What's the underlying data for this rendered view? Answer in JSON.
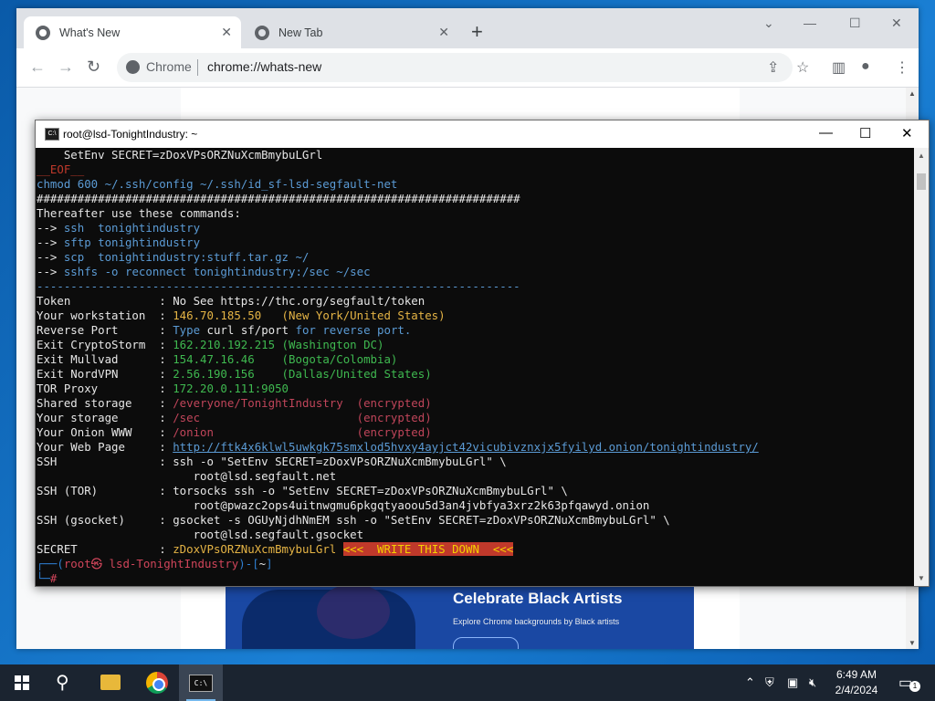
{
  "browser": {
    "tabs": [
      {
        "label": "What's New",
        "active": true
      },
      {
        "label": "New Tab",
        "active": false
      }
    ],
    "new_tab_symbol": "+",
    "omnibox": {
      "chip": "Chrome",
      "url": "chrome://whats-new"
    },
    "banner": {
      "title": "Celebrate Black Artists",
      "subtitle": "Explore Chrome backgrounds by Black artists"
    }
  },
  "terminal": {
    "title": "root@lsd-TonightIndustry: ~",
    "lines": [
      [
        {
          "t": "    SetEnv SECRET=zDoxVPsORZNuXcmBmybuLGrl",
          "c": "white"
        }
      ],
      [
        {
          "t": "__EOF__",
          "c": "red"
        }
      ],
      [
        {
          "t": "chmod 600 ~/.ssh/config ~/.ssh/id_sf-lsd-segfault-net",
          "c": "blue"
        }
      ],
      [
        {
          "t": "#######################################################################",
          "c": "white"
        }
      ],
      [
        {
          "t": "Thereafter use these commands:",
          "c": "white"
        }
      ],
      [
        {
          "t": "--> ",
          "c": "white"
        },
        {
          "t": "ssh  tonightindustry",
          "c": "blue"
        }
      ],
      [
        {
          "t": "--> ",
          "c": "white"
        },
        {
          "t": "sftp tonightindustry",
          "c": "blue"
        }
      ],
      [
        {
          "t": "--> ",
          "c": "white"
        },
        {
          "t": "scp  tonightindustry:stuff.tar.gz ~/",
          "c": "blue"
        }
      ],
      [
        {
          "t": "--> ",
          "c": "white"
        },
        {
          "t": "sshfs -o reconnect tonightindustry:/sec ~/sec",
          "c": "blue"
        }
      ],
      [
        {
          "t": "-----------------------------------------------------------------------",
          "c": "blue"
        }
      ],
      [
        {
          "t": "Token             : No See https://thc.org/segfault/token",
          "c": "white"
        }
      ],
      [
        {
          "t": "Your workstation  : ",
          "c": "white"
        },
        {
          "t": "146.70.185.50   (New York/United States)",
          "c": "orange"
        }
      ],
      [
        {
          "t": "Reverse Port      : ",
          "c": "white"
        },
        {
          "t": "Type ",
          "c": "blue"
        },
        {
          "t": "curl sf/port",
          "c": "white"
        },
        {
          "t": " for reverse port.",
          "c": "blue"
        }
      ],
      [
        {
          "t": "Exit CryptoStorm  : ",
          "c": "white"
        },
        {
          "t": "162.210.192.215 (Washington DC)",
          "c": "green"
        }
      ],
      [
        {
          "t": "Exit Mullvad      : ",
          "c": "white"
        },
        {
          "t": "154.47.16.46    (Bogota/Colombia)",
          "c": "green"
        }
      ],
      [
        {
          "t": "Exit NordVPN      : ",
          "c": "white"
        },
        {
          "t": "2.56.190.156    (Dallas/United States)",
          "c": "green"
        }
      ],
      [
        {
          "t": "TOR Proxy         : ",
          "c": "white"
        },
        {
          "t": "172.20.0.111:9050",
          "c": "green"
        }
      ],
      [
        {
          "t": "Shared storage    : ",
          "c": "white"
        },
        {
          "t": "/everyone/TonightIndustry  (encrypted)",
          "c": "pink"
        }
      ],
      [
        {
          "t": "Your storage      : ",
          "c": "white"
        },
        {
          "t": "/sec                       (encrypted)",
          "c": "pink"
        }
      ],
      [
        {
          "t": "Your Onion WWW    : ",
          "c": "white"
        },
        {
          "t": "/onion                     (encrypted)",
          "c": "pink"
        }
      ],
      [
        {
          "t": "Your Web Page     : ",
          "c": "white"
        },
        {
          "t": "http://ftk4x6klwl5uwkgk75smxlod5hvxy4ayjct42vicubivznxjx5fyilyd.onion/tonightindustry/",
          "c": "link"
        }
      ],
      [
        {
          "t": "SSH               : ssh -o \"SetEnv SECRET=zDoxVPsORZNuXcmBmybuLGrl\" \\",
          "c": "white"
        }
      ],
      [
        {
          "t": "                       root@lsd.segfault.net",
          "c": "white"
        }
      ],
      [
        {
          "t": "SSH (TOR)         : torsocks ssh -o \"SetEnv SECRET=zDoxVPsORZNuXcmBmybuLGrl\" \\",
          "c": "white"
        }
      ],
      [
        {
          "t": "                       root@pwazc2ops4uitnwgmu6pkgqtyaoou5d3an4jvbfya3xrz2k63pfqawyd.onion",
          "c": "white"
        }
      ],
      [
        {
          "t": "SSH (gsocket)     : gsocket -s OGUyNjdhNmEM ssh -o \"SetEnv SECRET=zDoxVPsORZNuXcmBmybuLGrl\" \\",
          "c": "white"
        }
      ],
      [
        {
          "t": "                       root@lsd.segfault.gsocket",
          "c": "white"
        }
      ],
      [
        {
          "t": "SECRET            : ",
          "c": "white"
        },
        {
          "t": "zDoxVPsORZNuXcmBmybuLGrl",
          "c": "orange"
        },
        {
          "t": " ",
          "c": "white"
        },
        {
          "t": "<<<  WRITE THIS DOWN  <<<",
          "c": "banner"
        }
      ],
      [
        {
          "t": "┌──(",
          "c": "cyanline"
        },
        {
          "t": "root㉿ lsd-TonightIndustry",
          "c": "prompt-red"
        },
        {
          "t": ")-[",
          "c": "cyanline"
        },
        {
          "t": "~",
          "c": "white"
        },
        {
          "t": "]",
          "c": "cyanline"
        }
      ],
      [
        {
          "t": "└─",
          "c": "cyanline"
        },
        {
          "t": "#",
          "c": "prompt-red"
        }
      ]
    ]
  },
  "taskbar": {
    "time": "6:49 AM",
    "date": "2/4/2024",
    "notification_count": "1"
  }
}
